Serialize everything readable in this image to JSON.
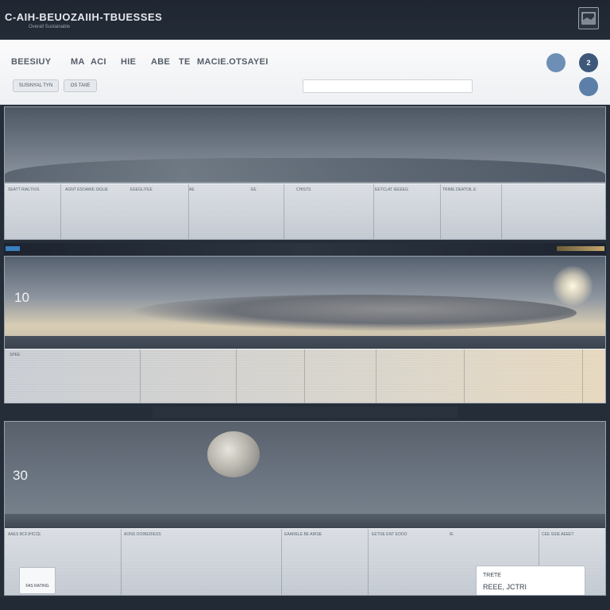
{
  "window": {
    "title": "C-AIH-BEUOZAIIH-TBUESSES",
    "subtitle": "Overall Sustainable"
  },
  "header": {
    "nav": [
      {
        "label": "BEESIUY"
      },
      {
        "label": "MA"
      },
      {
        "label": "ACI"
      },
      {
        "label": "HIE"
      },
      {
        "label": "ABE"
      },
      {
        "label": "TE"
      },
      {
        "label": "MACIE.OTSAYEI"
      }
    ],
    "chips": [
      {
        "label": "SUSINYAL TYN"
      },
      {
        "label": "OS TAIIE"
      }
    ],
    "search": {
      "value": "",
      "placeholder": ""
    },
    "buttons": [
      {
        "label": ""
      },
      {
        "label": "2"
      },
      {
        "label": ""
      }
    ]
  },
  "panels": [
    {
      "step": "",
      "columns": [
        "SEATT RIALTIVG",
        "AGNT ESOAWE SIGUE",
        "EEEGLITEE",
        "AE",
        "EE",
        "CHISTS",
        "EETCLAT IEEEEG",
        "TRIME DEATOIL E",
        ""
      ]
    },
    {
      "step": "10",
      "columns": [
        "SPEE",
        "",
        "",
        "",
        "",
        "",
        "",
        "",
        ""
      ]
    },
    {
      "step": "30",
      "columns": [
        "AAES BCFJHCCE",
        "AONS OOINEDIESS",
        "EAARELE BE AIRSE",
        "EETOE ENT EOOO",
        "IE",
        "CEE SSIE AEEET",
        "",
        "",
        ""
      ],
      "small_card": "FAS RATING",
      "big_card": {
        "label": "TRETE",
        "value": "REEE, JCTRI"
      }
    }
  ],
  "colors": {
    "topbar": "#242c37",
    "header": "#f5f6f8",
    "accent_blue": "#5b7fa8",
    "accent_orange": "#d56a36"
  },
  "icons": {
    "window_button": "window-icon"
  }
}
